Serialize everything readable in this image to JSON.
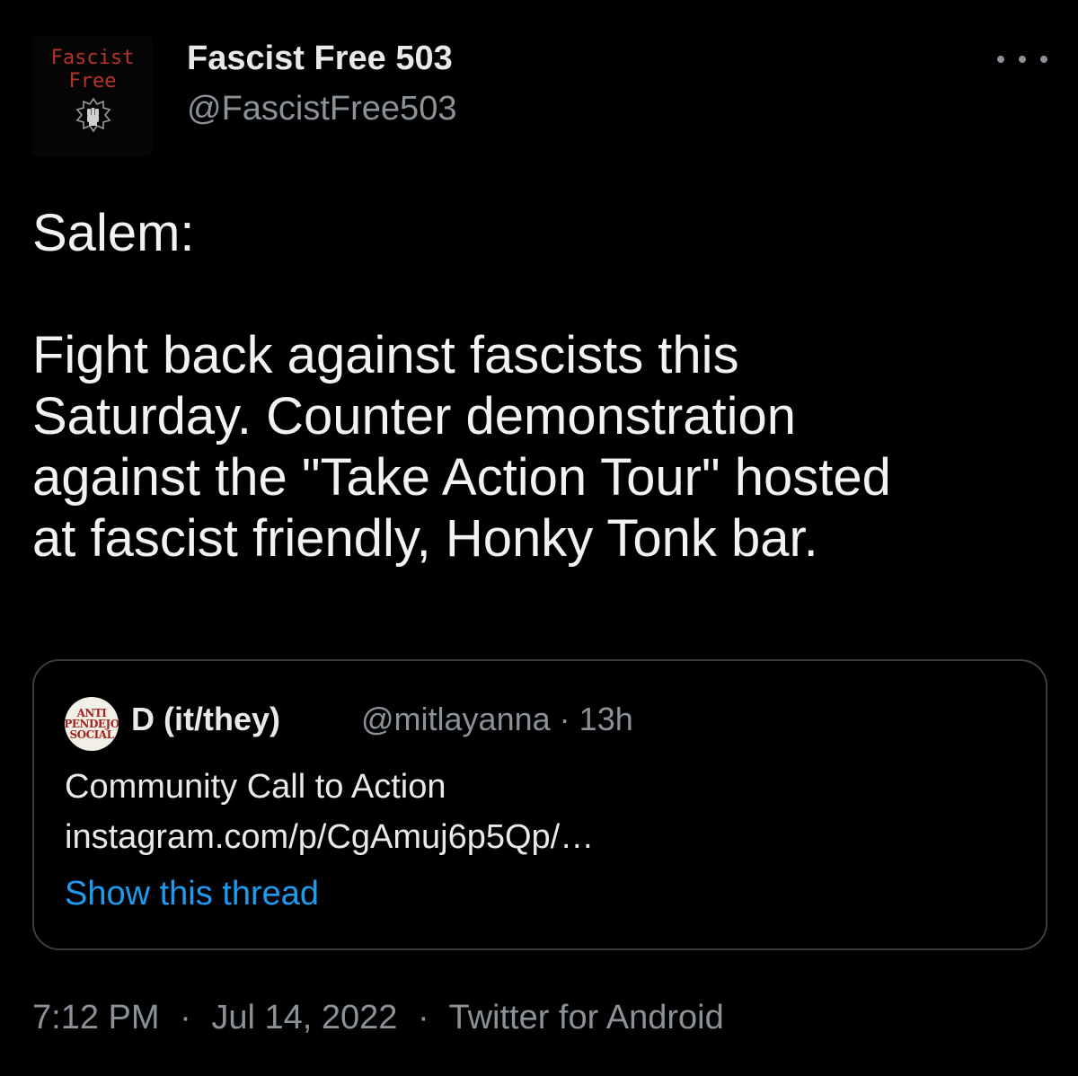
{
  "author": {
    "display_name": "Fascist Free 503",
    "handle": "@FascistFree503",
    "avatar": {
      "text": "Fascist\nFree",
      "icon": "raised-fist-icon",
      "text_color": "#b8322c"
    }
  },
  "more_icon": "more-horizontal-icon",
  "tweet": {
    "text": "Salem:\n\nFight back against fascists this\nSaturday. Counter demonstration\nagainst the \"Take Action Tour\" hosted\nat fascist friendly, Honky Tonk bar."
  },
  "quoted_tweet": {
    "avatar": {
      "lines": [
        "ANTI",
        "PENDEJO",
        "SOCIAL"
      ],
      "text_color": "#a3231d"
    },
    "display_name": "D (it/they)",
    "handle": "@mitlayanna",
    "separator": "·",
    "time_ago": "13h",
    "text": "Community Call to Action\ninstagram.com/p/CgAmuj6p5Qp/…",
    "show_thread_label": "Show this thread"
  },
  "footer": {
    "time": "7:12 PM",
    "separator": "·",
    "date": "Jul 14, 2022",
    "source": "Twitter for Android"
  },
  "colors": {
    "background": "#000000",
    "primary_text": "#e7e9ea",
    "secondary_text": "#8b9198",
    "link": "#1d9bf0",
    "border": "#3a3d41"
  }
}
